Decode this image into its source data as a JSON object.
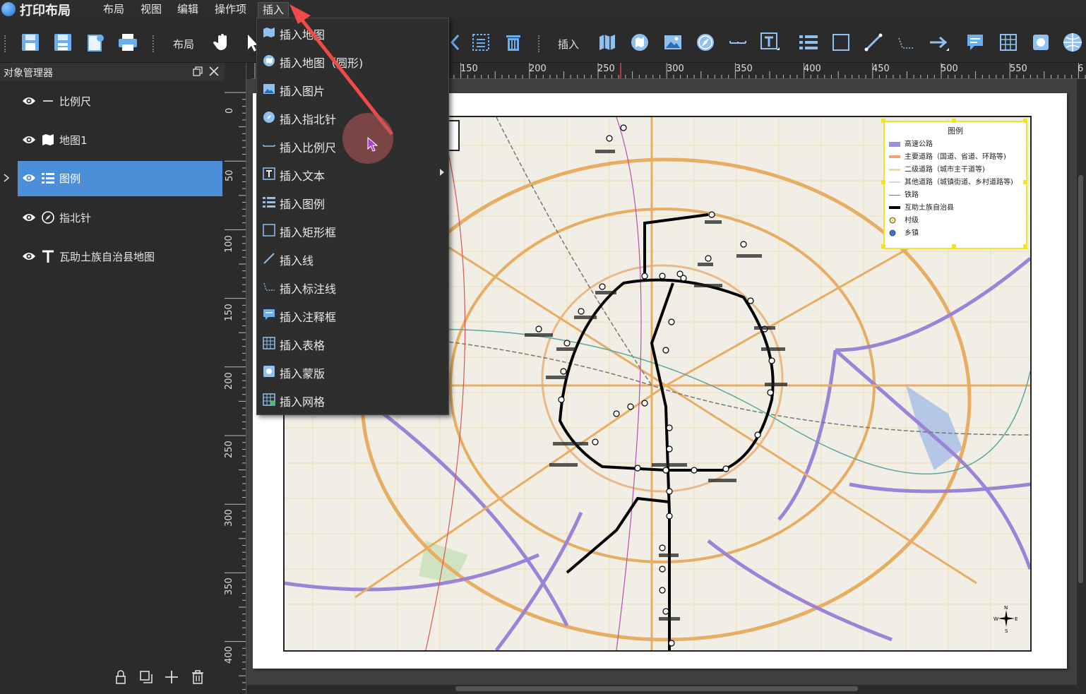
{
  "menubar": {
    "app_title": "打印布局",
    "items": [
      "布局",
      "视图",
      "编辑",
      "操作项",
      "插入"
    ]
  },
  "toolbar": {
    "layout_label": "布局",
    "insert_label": "插入"
  },
  "object_manager": {
    "title": "对象管理器",
    "items": [
      {
        "label": "比例尺",
        "icon": "scalebar-icon"
      },
      {
        "label": "地图1",
        "icon": "map-icon"
      },
      {
        "label": "图例",
        "icon": "legend-icon",
        "selected": true
      },
      {
        "label": "指北针",
        "icon": "compass-icon"
      },
      {
        "label": "瓦助土族自治县地图",
        "icon": "text-icon"
      }
    ]
  },
  "ruler": {
    "top": [
      "150",
      "200",
      "250",
      "300",
      "350",
      "400",
      "450",
      "500",
      "550",
      "6"
    ],
    "left": [
      "0",
      "50",
      "100",
      "150",
      "200",
      "250",
      "300",
      "350",
      "400"
    ]
  },
  "insert_menu": {
    "items": [
      {
        "label": "插入地图",
        "icon": "map-icon"
      },
      {
        "label": "插入地图（圆形)",
        "icon": "round-map-icon"
      },
      {
        "label": "插入图片",
        "icon": "image-icon"
      },
      {
        "label": "插入指北针",
        "icon": "compass-icon"
      },
      {
        "label": "插入比例尺",
        "icon": "scalebar-icon"
      },
      {
        "label": "插入文本",
        "icon": "text-icon",
        "submenu": true
      },
      {
        "label": "插入图例",
        "icon": "legend-icon"
      },
      {
        "label": "插入矩形框",
        "icon": "rectangle-icon"
      },
      {
        "label": "插入线",
        "icon": "line-icon"
      },
      {
        "label": "插入标注线",
        "icon": "callout-line-icon"
      },
      {
        "label": "插入注释框",
        "icon": "comment-icon"
      },
      {
        "label": "插入表格",
        "icon": "table-icon"
      },
      {
        "label": "插入蒙版",
        "icon": "mask-icon"
      },
      {
        "label": "插入网格",
        "icon": "grid-icon"
      }
    ]
  },
  "legend": {
    "title": "图例",
    "rows": [
      {
        "label": "高速公路",
        "color": "#9d8fd9"
      },
      {
        "label": "主要道路（国道、省道、环路等)",
        "color": "#f0a27a"
      },
      {
        "label": "二级道路（城市主干道等)",
        "color": "#f3d9a0"
      },
      {
        "label": "其他道路（城镇街道、乡村道路等)",
        "color": "#e6e6e6"
      },
      {
        "label": "铁路",
        "color": "#777777"
      },
      {
        "label": "互助土族自治县",
        "color": "#000000"
      },
      {
        "label": "村级",
        "color": "#f6e27a"
      },
      {
        "label": "乡镇",
        "color": "#3d76d9"
      }
    ]
  },
  "compass": {
    "n": "N",
    "s": "S",
    "e": "E",
    "w": "W"
  },
  "colors": {
    "accent": "#4c8fd8",
    "legend_border": "#f2e12e",
    "arrow": "#f04a4a"
  }
}
